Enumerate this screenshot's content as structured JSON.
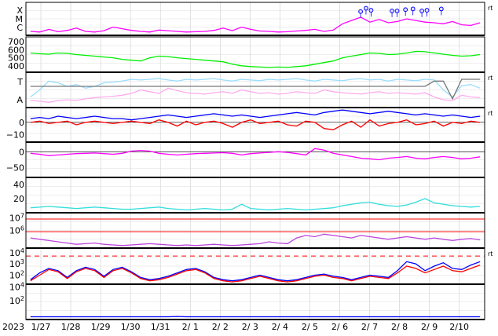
{
  "chart_data": {
    "type": "line",
    "title": "",
    "year_label": "2023",
    "x_ticks": [
      "1/27",
      "1/28",
      "1/29",
      "1/30",
      "1/31",
      "2/ 1",
      "2/ 2",
      "2/ 3",
      "2/ 4",
      "2/ 5",
      "2/ 6",
      "2/ 7",
      "2/ 8",
      "2/ 9",
      "2/10"
    ],
    "x_range_days": [
      0,
      15.35
    ],
    "right_marker": "rt",
    "grid": true,
    "colors": {
      "magenta": "#ff00ff",
      "green": "#00ee00",
      "lightblue": "#99ddff",
      "pink": "#ffaaee",
      "red": "#ff0000",
      "blue": "#0000ff",
      "purple": "#bb44dd",
      "cyan": "#33dddd",
      "gray": "#777777",
      "black": "#000000"
    },
    "panels": [
      {
        "id": "xray",
        "scale": "categorical",
        "tick_labels": [
          "X",
          "M",
          "C"
        ],
        "series": [
          {
            "color": "magenta",
            "values": [
              0.12,
              0.1,
              0.18,
              0.11,
              0.15,
              0.22,
              0.12,
              0.1,
              0.14,
              0.25,
              0.2,
              0.15,
              0.12,
              0.1,
              0.16,
              0.14,
              0.12,
              0.1,
              0.11,
              0.12,
              0.15,
              0.22,
              0.14,
              0.25,
              0.18,
              0.13,
              0.12,
              0.1,
              0.11,
              0.13,
              0.15,
              0.18,
              0.12,
              0.16,
              0.35,
              0.45,
              0.55,
              0.4,
              0.48,
              0.38,
              0.42,
              0.5,
              0.45,
              0.4,
              0.38,
              0.35,
              0.42,
              0.32,
              0.3,
              0.38
            ]
          }
        ],
        "flare_markers": [
          11.2,
          11.38,
          11.55,
          12.25,
          12.42,
          12.7,
          12.95,
          13.25,
          13.42,
          13.9
        ],
        "flare_levels": [
          0.72,
          0.82,
          0.76,
          0.74,
          0.74,
          0.78,
          0.8,
          0.74,
          0.76,
          0.8
        ]
      },
      {
        "id": "wind-speed",
        "scale": "linear",
        "tick_labels": [
          "700",
          "600",
          "500",
          "400"
        ],
        "ylim": [
          320,
          760
        ],
        "series": [
          {
            "color": "green",
            "values": [
              560,
              550,
              545,
              560,
              555,
              540,
              530,
              520,
              510,
              500,
              480,
              470,
              460,
              500,
              520,
              515,
              500,
              490,
              480,
              470,
              460,
              450,
              420,
              400,
              390,
              385,
              380,
              385,
              380,
              390,
              400,
              420,
              440,
              460,
              500,
              520,
              540,
              560,
              555,
              540,
              545,
              560,
              580,
              575,
              560,
              545,
              530,
              520,
              525,
              540
            ]
          }
        ]
      },
      {
        "id": "imf-sector",
        "scale": "categorical",
        "tick_labels": [
          "T",
          "A"
        ],
        "series": [
          {
            "color": "lightblue",
            "values": [
              0.3,
              0.5,
              0.75,
              0.7,
              0.6,
              0.65,
              0.55,
              0.6,
              0.7,
              0.72,
              0.75,
              0.8,
              0.78,
              0.8,
              0.82,
              0.78,
              0.75,
              0.8,
              0.78,
              0.8,
              0.82,
              0.78,
              0.75,
              0.8,
              0.78,
              0.76,
              0.8,
              0.78,
              0.8,
              0.82,
              0.78,
              0.75,
              0.8,
              0.78,
              0.76,
              0.8,
              0.82,
              0.78,
              0.8,
              0.75,
              0.8,
              0.78,
              0.76,
              0.8,
              0.78,
              0.5,
              0.3,
              0.62,
              0.65,
              0.55
            ]
          },
          {
            "color": "pink",
            "values": [
              0.2,
              0.18,
              0.15,
              0.2,
              0.22,
              0.2,
              0.25,
              0.28,
              0.3,
              0.32,
              0.35,
              0.4,
              0.5,
              0.45,
              0.4,
              0.55,
              0.48,
              0.42,
              0.4,
              0.38,
              0.42,
              0.45,
              0.4,
              0.5,
              0.45,
              0.4,
              0.42,
              0.38,
              0.4,
              0.45,
              0.42,
              0.4,
              0.5,
              0.45,
              0.42,
              0.4,
              0.38,
              0.42,
              0.45,
              0.4,
              0.42,
              0.4,
              0.38,
              0.42,
              0.3,
              0.22,
              0.2,
              0.35,
              0.3,
              0.28
            ]
          },
          {
            "color": "gray",
            "values": [
              0.6,
              0.6,
              0.6,
              0.6,
              0.6,
              0.6,
              0.6,
              0.6,
              0.6,
              0.6,
              0.6,
              0.6,
              0.6,
              0.6,
              0.6,
              0.6,
              0.6,
              0.6,
              0.6,
              0.6,
              0.6,
              0.6,
              0.6,
              0.6,
              0.6,
              0.6,
              0.6,
              0.6,
              0.6,
              0.6,
              0.6,
              0.6,
              0.6,
              0.6,
              0.6,
              0.6,
              0.6,
              0.6,
              0.6,
              0.6,
              0.6,
              0.6,
              0.6,
              0.6,
              0.75,
              0.75,
              0.25,
              0.8,
              0.8,
              0.8
            ]
          }
        ]
      },
      {
        "id": "imf-bz",
        "scale": "linear",
        "tick_labels": [
          "0",
          "−10"
        ],
        "tick_values": [
          0,
          -10
        ],
        "ylim": [
          -16,
          12
        ],
        "series": [
          {
            "color": "blue",
            "values": [
              3,
              4,
              3,
              5,
              4,
              3,
              4,
              5,
              4,
              3,
              3,
              2,
              3,
              4,
              5,
              6,
              5,
              4,
              5,
              6,
              7,
              6,
              5,
              6,
              5,
              4,
              5,
              6,
              7,
              8,
              7,
              6,
              8,
              9,
              10,
              9,
              8,
              7,
              8,
              9,
              8,
              7,
              6,
              7,
              6,
              5,
              6,
              5,
              4,
              5
            ]
          },
          {
            "color": "red",
            "values": [
              0,
              1,
              -1,
              0,
              1,
              -2,
              0,
              1,
              0,
              -1,
              0,
              1,
              0,
              -1,
              2,
              0,
              -3,
              1,
              -2,
              0,
              1,
              -1,
              -4,
              0,
              2,
              -1,
              0,
              1,
              -2,
              -3,
              1,
              0,
              -5,
              -6,
              -2,
              1,
              -4,
              2,
              -3,
              -1,
              0,
              2,
              -2,
              -1,
              1,
              -3,
              0,
              -1,
              1,
              0
            ]
          }
        ]
      },
      {
        "id": "dst",
        "scale": "linear",
        "tick_labels": [
          "0",
          "−50"
        ],
        "tick_values": [
          0,
          -50
        ],
        "ylim": [
          -80,
          30
        ],
        "series": [
          {
            "color": "magenta",
            "values": [
              -5,
              -8,
              -12,
              -10,
              -8,
              -6,
              -5,
              -4,
              -6,
              -8,
              -5,
              2,
              4,
              2,
              -5,
              -8,
              -10,
              -8,
              -6,
              -5,
              -4,
              -3,
              -5,
              -10,
              -6,
              -4,
              -2,
              0,
              -2,
              -6,
              -10,
              10,
              5,
              -5,
              -10,
              -15,
              -20,
              -22,
              -25,
              -20,
              -18,
              -15,
              -20,
              -22,
              -18,
              -15,
              -18,
              -22,
              -20,
              -16
            ]
          }
        ]
      },
      {
        "id": "kp",
        "scale": "linear",
        "tick_labels": [
          "40",
          "20"
        ],
        "tick_values": [
          40,
          20
        ],
        "ylim": [
          0,
          50
        ],
        "series": [
          {
            "color": "cyan",
            "values": [
              7,
              8,
              9,
              8,
              7,
              6,
              7,
              8,
              7,
              6,
              5,
              5,
              6,
              7,
              8,
              6,
              5,
              4,
              5,
              6,
              5,
              4,
              5,
              12,
              6,
              5,
              4,
              5,
              6,
              5,
              4,
              5,
              6,
              7,
              10,
              12,
              14,
              15,
              12,
              10,
              9,
              11,
              15,
              20,
              14,
              12,
              10,
              9,
              8,
              9
            ]
          }
        ]
      },
      {
        "id": "electron",
        "scale": "log",
        "tick_labels": [
          "10^7",
          "10^6"
        ],
        "tick_exponents": [
          7,
          6
        ],
        "ylim_exp": [
          4.6,
          7.4
        ],
        "thresholds_exp": [
          6.9,
          5.9
        ],
        "series": [
          {
            "color": "purple",
            "values": [
              5.4,
              5.3,
              5.2,
              5.1,
              5.0,
              4.9,
              4.95,
              5.0,
              4.9,
              4.85,
              4.8,
              4.85,
              4.9,
              4.95,
              4.9,
              4.85,
              4.8,
              4.85,
              4.8,
              4.85,
              4.9,
              4.85,
              4.8,
              4.85,
              4.9,
              4.95,
              5.1,
              5.0,
              4.95,
              5.4,
              5.6,
              5.5,
              5.7,
              5.6,
              5.5,
              5.4,
              5.6,
              5.5,
              5.4,
              5.3,
              5.4,
              5.5,
              5.4,
              5.3,
              5.4,
              5.3,
              5.2,
              5.3,
              5.35,
              5.25
            ]
          }
        ]
      },
      {
        "id": "proton",
        "scale": "log",
        "tick_labels": [
          "10^4",
          "10^3",
          "10^2"
        ],
        "tick_exponents": [
          4,
          3,
          2
        ],
        "ylim_exp": [
          1.2,
          4.4
        ],
        "thresholds_exp": [
          3.7
        ],
        "series": [
          {
            "color": "blue",
            "values": [
              1.6,
              2.2,
              2.6,
              2.4,
              1.8,
              2.4,
              2.7,
              2.5,
              1.9,
              2.5,
              2.7,
              2.3,
              1.8,
              1.6,
              1.7,
              1.9,
              2.2,
              2.5,
              2.6,
              2.3,
              1.8,
              1.6,
              1.5,
              1.6,
              1.8,
              2.0,
              1.8,
              1.6,
              1.5,
              1.6,
              1.8,
              2.0,
              2.1,
              1.9,
              1.8,
              1.6,
              1.8,
              2.0,
              1.9,
              1.8,
              2.4,
              3.2,
              3.0,
              2.4,
              2.8,
              3.1,
              2.6,
              2.5,
              2.9,
              3.2
            ]
          },
          {
            "color": "red",
            "values": [
              1.5,
              2.0,
              2.5,
              2.3,
              1.7,
              2.3,
              2.6,
              2.4,
              1.8,
              2.4,
              2.6,
              2.2,
              1.7,
              1.5,
              1.6,
              1.8,
              2.1,
              2.4,
              2.5,
              2.2,
              1.7,
              1.5,
              1.4,
              1.5,
              1.7,
              1.9,
              1.7,
              1.5,
              1.4,
              1.5,
              1.7,
              1.9,
              2.0,
              1.8,
              1.7,
              1.5,
              1.7,
              1.9,
              1.8,
              1.7,
              2.2,
              2.8,
              2.6,
              2.2,
              2.5,
              2.8,
              2.4,
              2.3,
              2.6,
              2.9
            ]
          }
        ]
      },
      {
        "id": "proton-high",
        "scale": "log",
        "tick_labels": [
          "10^4",
          "10^2"
        ],
        "tick_exponents": [
          4,
          2
        ],
        "ylim_exp": [
          -0.8,
          4.4
        ],
        "series": [
          {
            "color": "blue",
            "values": [
              -0.4,
              -0.4,
              -0.4,
              -0.4,
              -0.4,
              -0.4,
              -0.4,
              -0.4,
              -0.4,
              -0.4,
              -0.4,
              -0.4,
              -0.4,
              -0.4,
              -0.4,
              -0.4,
              -0.35,
              -0.4,
              -0.4,
              -0.4,
              -0.4,
              -0.4,
              -0.4,
              -0.4,
              -0.4,
              -0.4,
              -0.4,
              -0.4,
              -0.4,
              -0.4,
              -0.4,
              -0.4,
              -0.4,
              -0.4,
              -0.4,
              -0.4,
              -0.4,
              -0.4,
              -0.4,
              -0.4,
              -0.4,
              -0.4,
              -0.4,
              -0.4,
              -0.4,
              -0.4,
              -0.4,
              -0.4,
              -0.4,
              -0.4
            ]
          }
        ]
      }
    ]
  }
}
